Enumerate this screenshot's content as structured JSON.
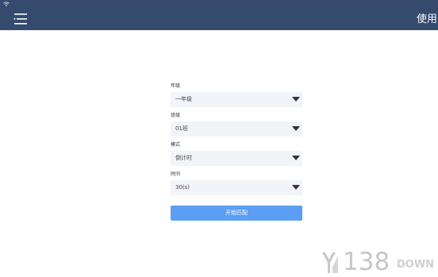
{
  "topbar": {
    "status_icon": "wifi-icon",
    "menu_icon": "menu-icon",
    "action_label": "使用"
  },
  "form": {
    "fields": [
      {
        "label": "年级",
        "value": "一年级"
      },
      {
        "label": "班级",
        "value": "01班"
      },
      {
        "label": "模式",
        "value": "倒计时"
      },
      {
        "label": "时间",
        "value": "30(s)"
      }
    ],
    "submit_label": "开始匹配"
  },
  "watermark": {
    "digits": "138",
    "suffix": "DOWN"
  },
  "colors": {
    "topbar": "#344b6e",
    "primary_button": "#5b9ef2",
    "select_background": "#f1f4f8"
  }
}
